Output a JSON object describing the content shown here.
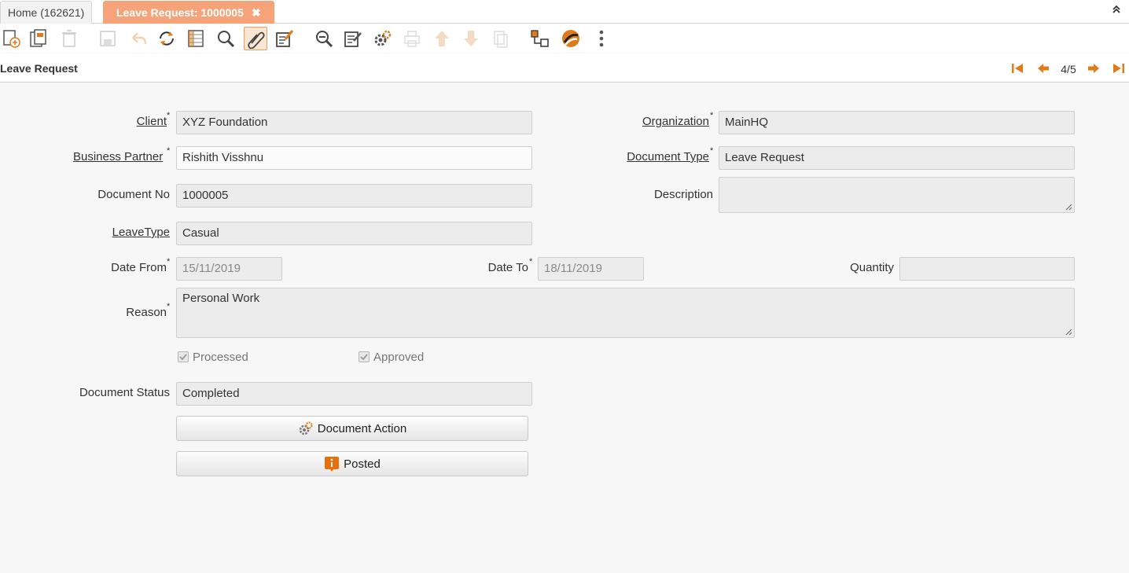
{
  "tabs": [
    {
      "label": "Home (162621)"
    },
    {
      "label": "Leave Request: 1000005",
      "close": "✖"
    }
  ],
  "collapse_icon": "double-chevron-up-icon",
  "toolbar": {
    "icons": [
      "new-record-icon",
      "copy-record-icon",
      "delete-icon",
      "save-icon",
      "undo-icon",
      "refresh-icon",
      "grid-toggle-icon",
      "find-icon",
      "attachment-icon",
      "chat-icon",
      "zoom-across-icon",
      "report-icon",
      "process-icon",
      "print-icon",
      "parent-record-icon",
      "detail-record-icon",
      "archive-icon",
      "product-info-icon",
      "workflow-icon",
      "more-icon"
    ],
    "active": "attachment-icon"
  },
  "header": {
    "title": "Leave Request",
    "page": "4/5"
  },
  "form": {
    "client": {
      "label": "Client",
      "value": "XYZ Foundation"
    },
    "organization": {
      "label": "Organization",
      "value": "MainHQ"
    },
    "business_partner": {
      "label": "Business Partner ",
      "value": "Rishith Visshnu"
    },
    "document_type": {
      "label": "Document Type",
      "value": "Leave Request"
    },
    "document_no": {
      "label": "Document No",
      "value": "1000005"
    },
    "description": {
      "label": "Description",
      "value": ""
    },
    "leave_type": {
      "label": "LeaveType",
      "value": "Casual"
    },
    "date_from": {
      "label": "Date From",
      "value": "15/11/2019"
    },
    "date_to": {
      "label": "Date To",
      "value": "18/11/2019"
    },
    "quantity": {
      "label": "Quantity",
      "value": ""
    },
    "reason": {
      "label": "Reason",
      "value": "Personal Work"
    },
    "processed": {
      "label": "Processed",
      "checked": true
    },
    "approved": {
      "label": "Approved",
      "checked": true
    },
    "document_status": {
      "label": "Document Status",
      "value": "Completed"
    },
    "required_mark": "*"
  },
  "buttons": {
    "document_action": "Document Action",
    "posted": "Posted"
  },
  "colors": {
    "accent": "#f6a37a",
    "icon_orange": "#e07b1a",
    "posted_badge": "#e8700c"
  }
}
